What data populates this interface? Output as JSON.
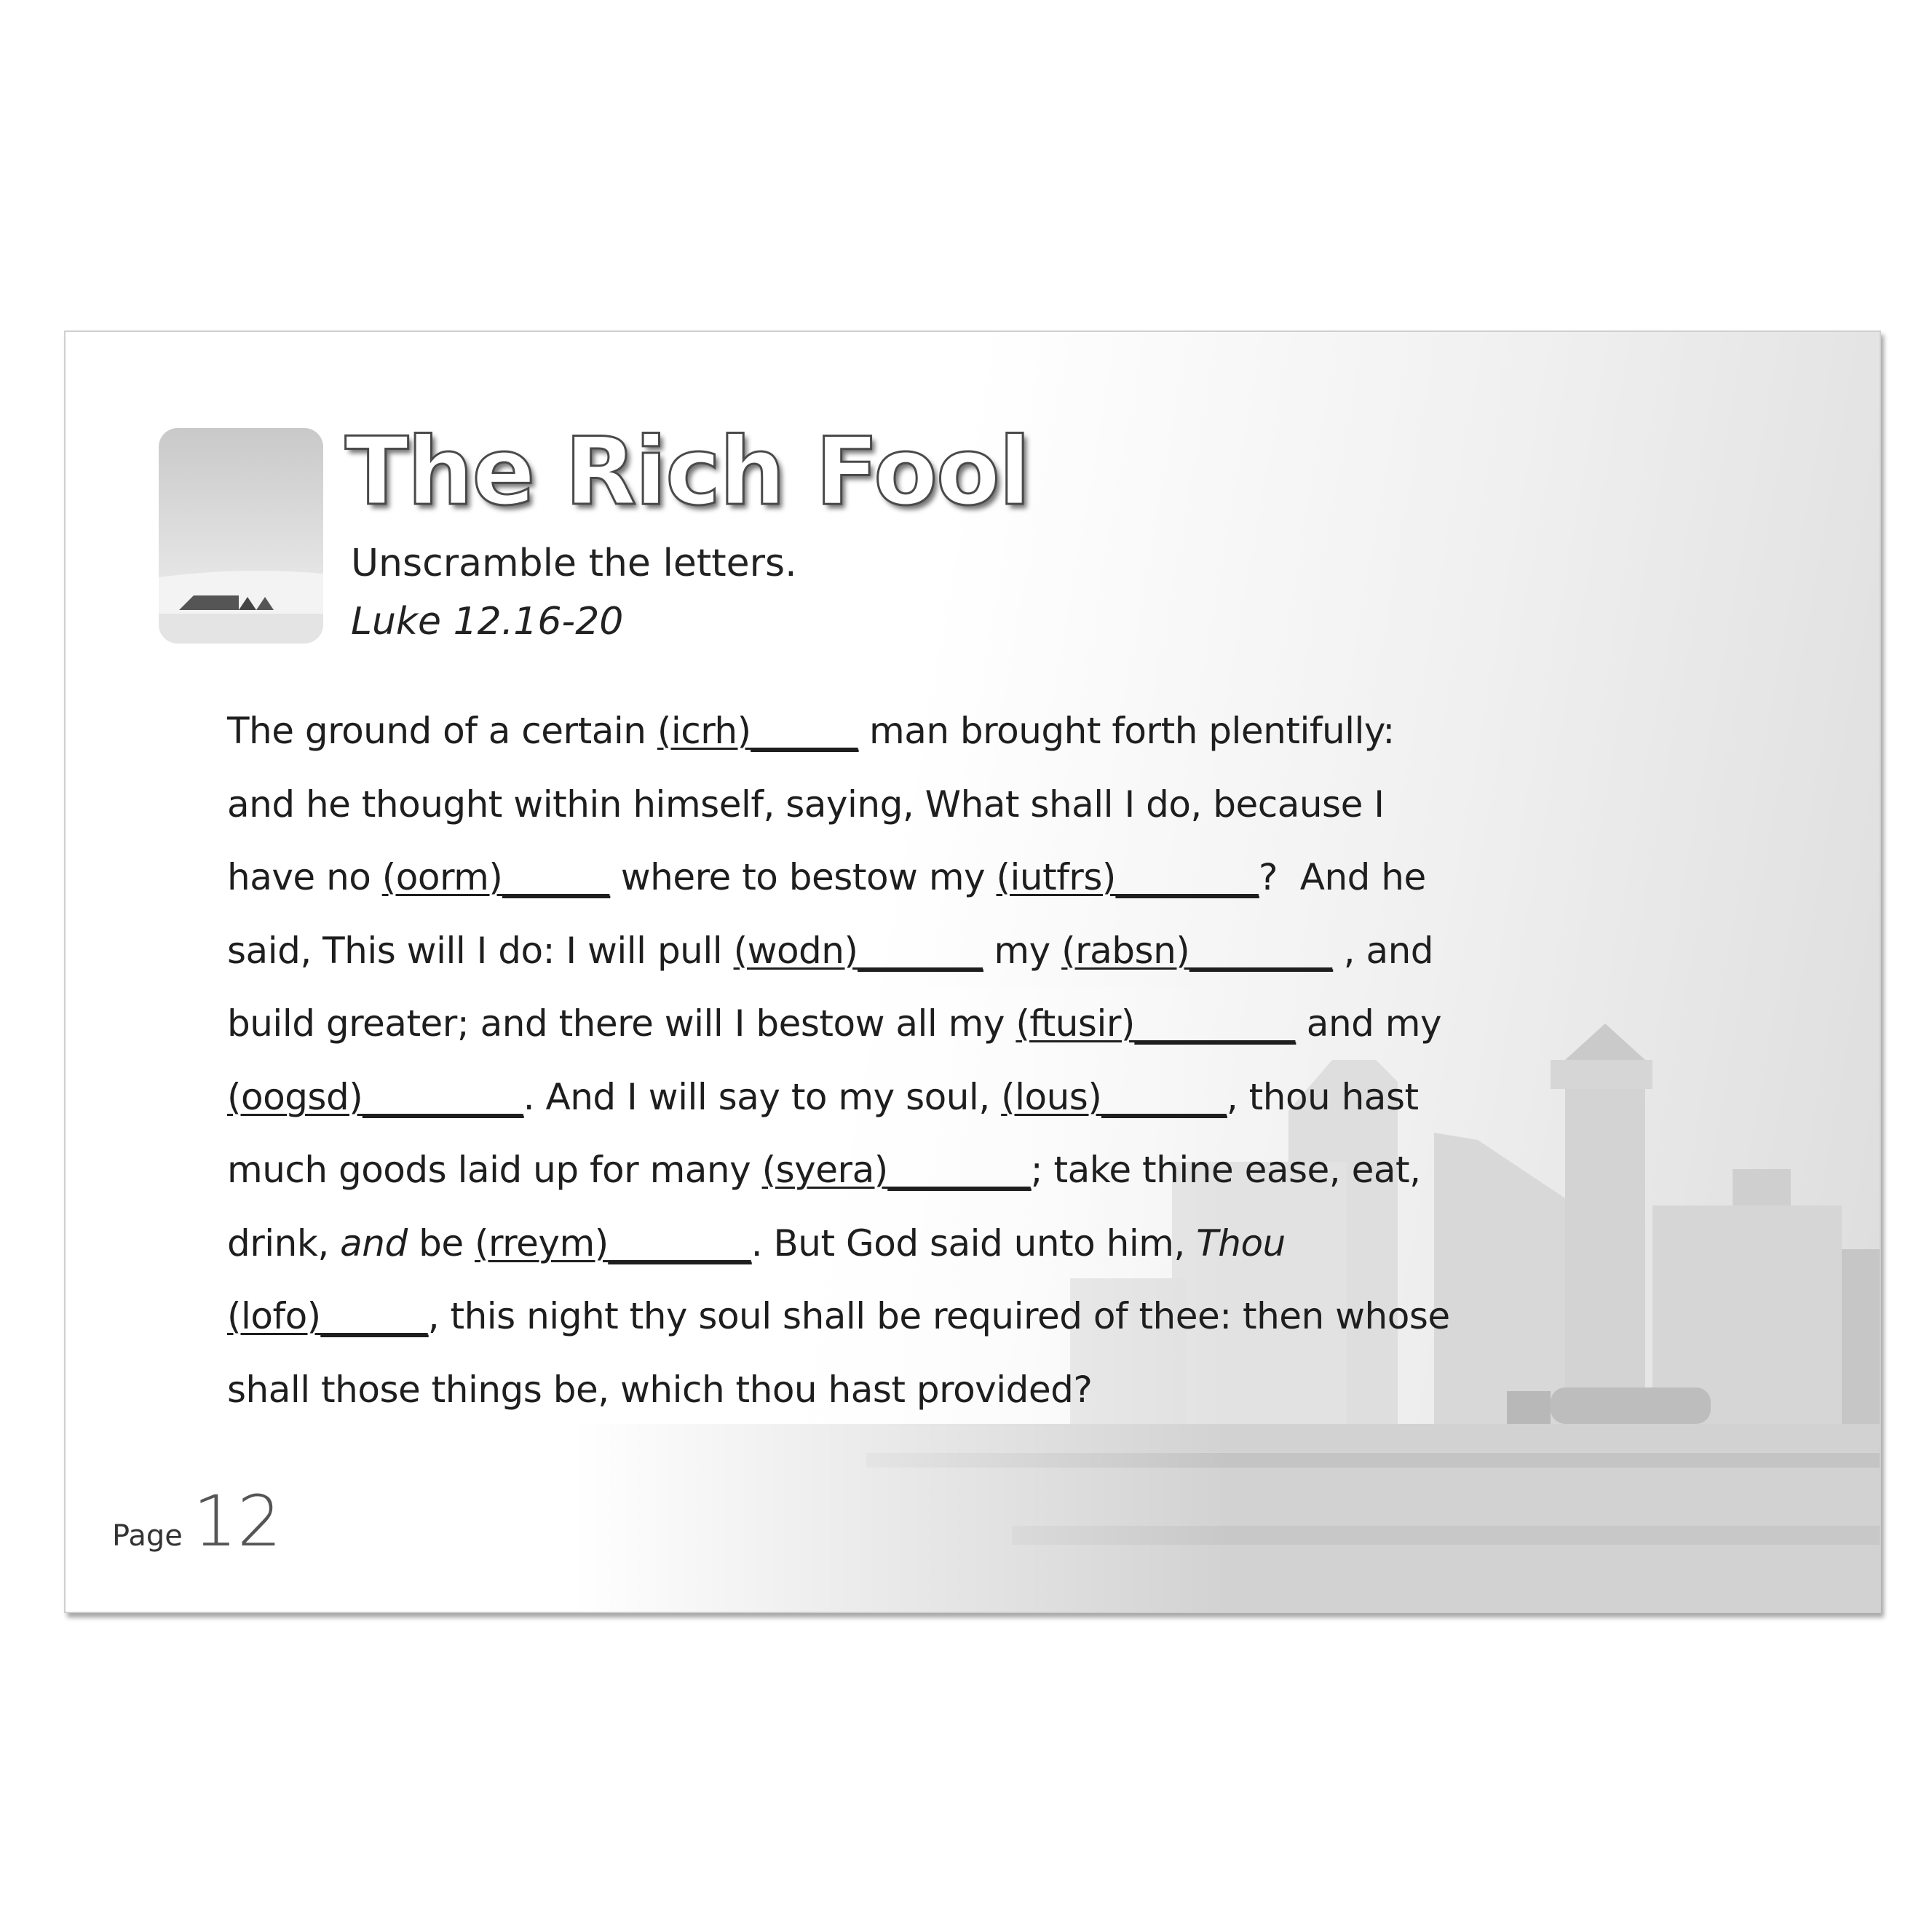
{
  "title": "The Rich Fool",
  "instruction": "Unscramble the letters.",
  "reference": "Luke 12.16-20",
  "passage": {
    "l1": {
      "a": "The ground of a certain ",
      "w1": "(icrh)______",
      "b": " man brought forth plentifully:"
    },
    "l2": {
      "a": "and he thought within himself, saying, What shall I do, because I"
    },
    "l3": {
      "a": "have no ",
      "w1": "(oorm)______",
      "b": " where to bestow my ",
      "w2": "(iutfrs)________",
      "c": "?  And he"
    },
    "l4": {
      "a": "said, This will I do: I will pull ",
      "w1": "(wodn)_______",
      "b": " my ",
      "w2": "(rabsn)________",
      "c": " , and"
    },
    "l5": {
      "a": "build greater; and there will I bestow all my ",
      "w1": "(ftusir)_________",
      "b": " and my"
    },
    "l6": {
      "w1": "(oogsd)_________",
      "a": ". And I will say to my soul, ",
      "w2": "(lous)_______",
      "b": ", thou hast"
    },
    "l7": {
      "a": "much goods laid up for many ",
      "w1": "(syera)________",
      "b": "; take thine ease, eat,"
    },
    "l8": {
      "a": "drink, ",
      "em1": "and",
      "b": " be ",
      "w1": "(rreym)________",
      "c": ". But God said unto him, ",
      "em2": "Thou"
    },
    "l9": {
      "w1": "(lofo)______",
      "a": ", this night thy soul shall be required of thee: then whose"
    },
    "l10": {
      "a": "shall those things be, which thou hast provided?"
    }
  },
  "footer": {
    "page_label": "Page",
    "page_number": "12"
  }
}
